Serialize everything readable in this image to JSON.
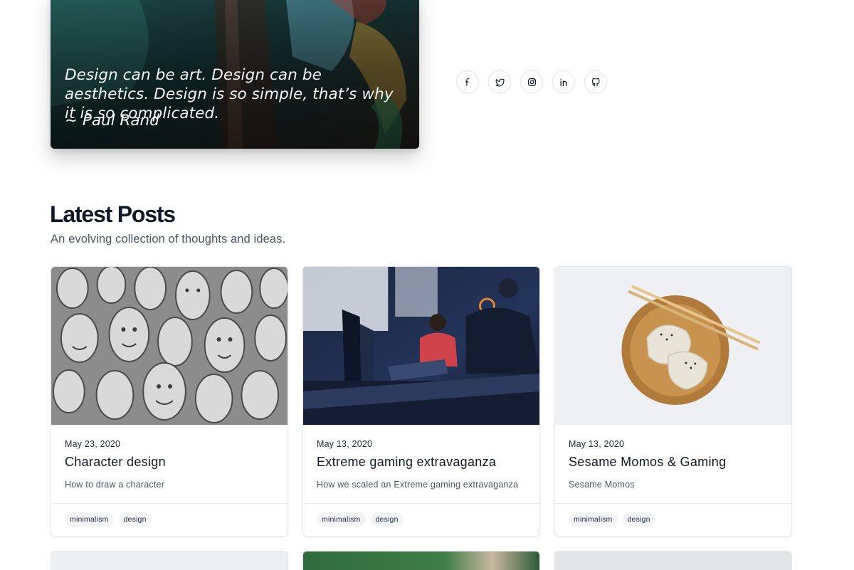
{
  "hero": {
    "quote": "Design can be art. Design can be aesthetics. Design is so simple, that’s why it is so complicated.",
    "author": "~ Paul Rand"
  },
  "social": [
    {
      "name": "facebook-icon",
      "label": "Facebook"
    },
    {
      "name": "twitter-icon",
      "label": "Twitter"
    },
    {
      "name": "instagram-icon",
      "label": "Instagram"
    },
    {
      "name": "linkedin-icon",
      "label": "LinkedIn"
    },
    {
      "name": "github-icon",
      "label": "GitHub"
    }
  ],
  "latest": {
    "title": "Latest Posts",
    "subtitle": "An evolving collection of thoughts and ideas."
  },
  "posts": [
    {
      "date": "May 23, 2020",
      "title": "Character design",
      "description": "How to draw a character",
      "tags": [
        "minimalism",
        "design"
      ],
      "image": "carved-stone-faces"
    },
    {
      "date": "May 13, 2020",
      "title": "Extreme gaming extravaganza",
      "description": "How we scaled an Extreme gaming extravaganza",
      "tags": [
        "minimalism",
        "design"
      ],
      "image": "gamers-at-computers"
    },
    {
      "date": "May 13, 2020",
      "title": "Sesame Momos & Gaming",
      "description": "Sesame Momos",
      "tags": [
        "minimalism",
        "design"
      ],
      "image": "dumplings-on-wooden-plate"
    }
  ],
  "colors": {
    "heading": "#111827",
    "muted": "#4b5563",
    "border": "#e5e7eb",
    "tag_bg": "#f3f4f6"
  }
}
